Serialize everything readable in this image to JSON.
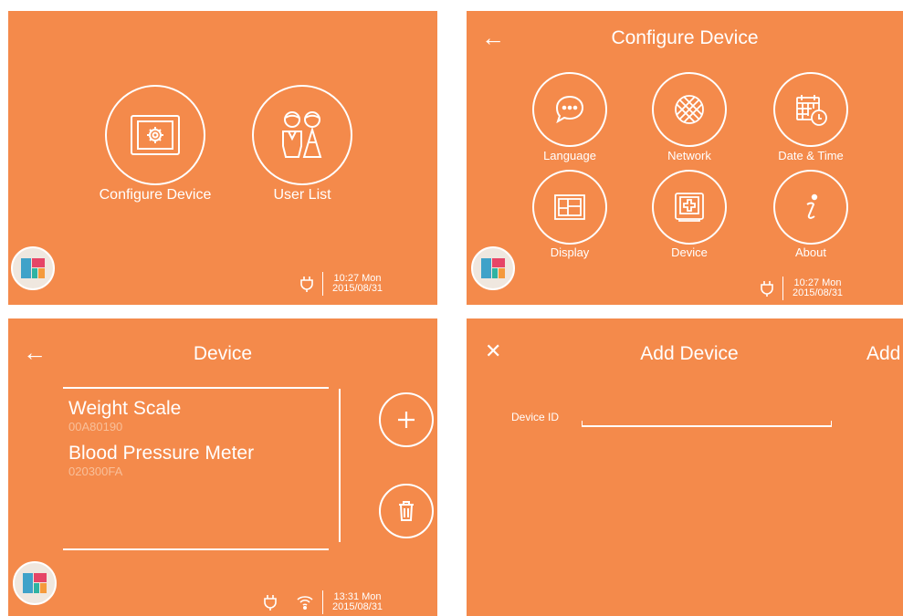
{
  "home": {
    "configure_label": "Configure Device",
    "userlist_label": "User List",
    "time": "10:27 Mon",
    "date": "2015/08/31"
  },
  "configure": {
    "title": "Configure Device",
    "items": [
      "Language",
      "Network",
      "Date & Time",
      "Display",
      "Device",
      "About"
    ],
    "time": "10:27 Mon",
    "date": "2015/08/31"
  },
  "device": {
    "title": "Device",
    "list": [
      {
        "name": "Weight Scale",
        "id": "00A80190"
      },
      {
        "name": "Blood Pressure Meter",
        "id": "020300FA"
      }
    ],
    "time": "13:31 Mon",
    "date": "2015/08/31"
  },
  "add_device": {
    "title": "Add Device",
    "add_label": "Add",
    "field_label": "Device ID",
    "field_value": ""
  },
  "colors": {
    "background": "#f48a4b",
    "tile_blue": "#3fa2c9",
    "tile_red": "#e64567",
    "tile_teal": "#2fb3a2",
    "tile_orange": "#f59a3c"
  }
}
